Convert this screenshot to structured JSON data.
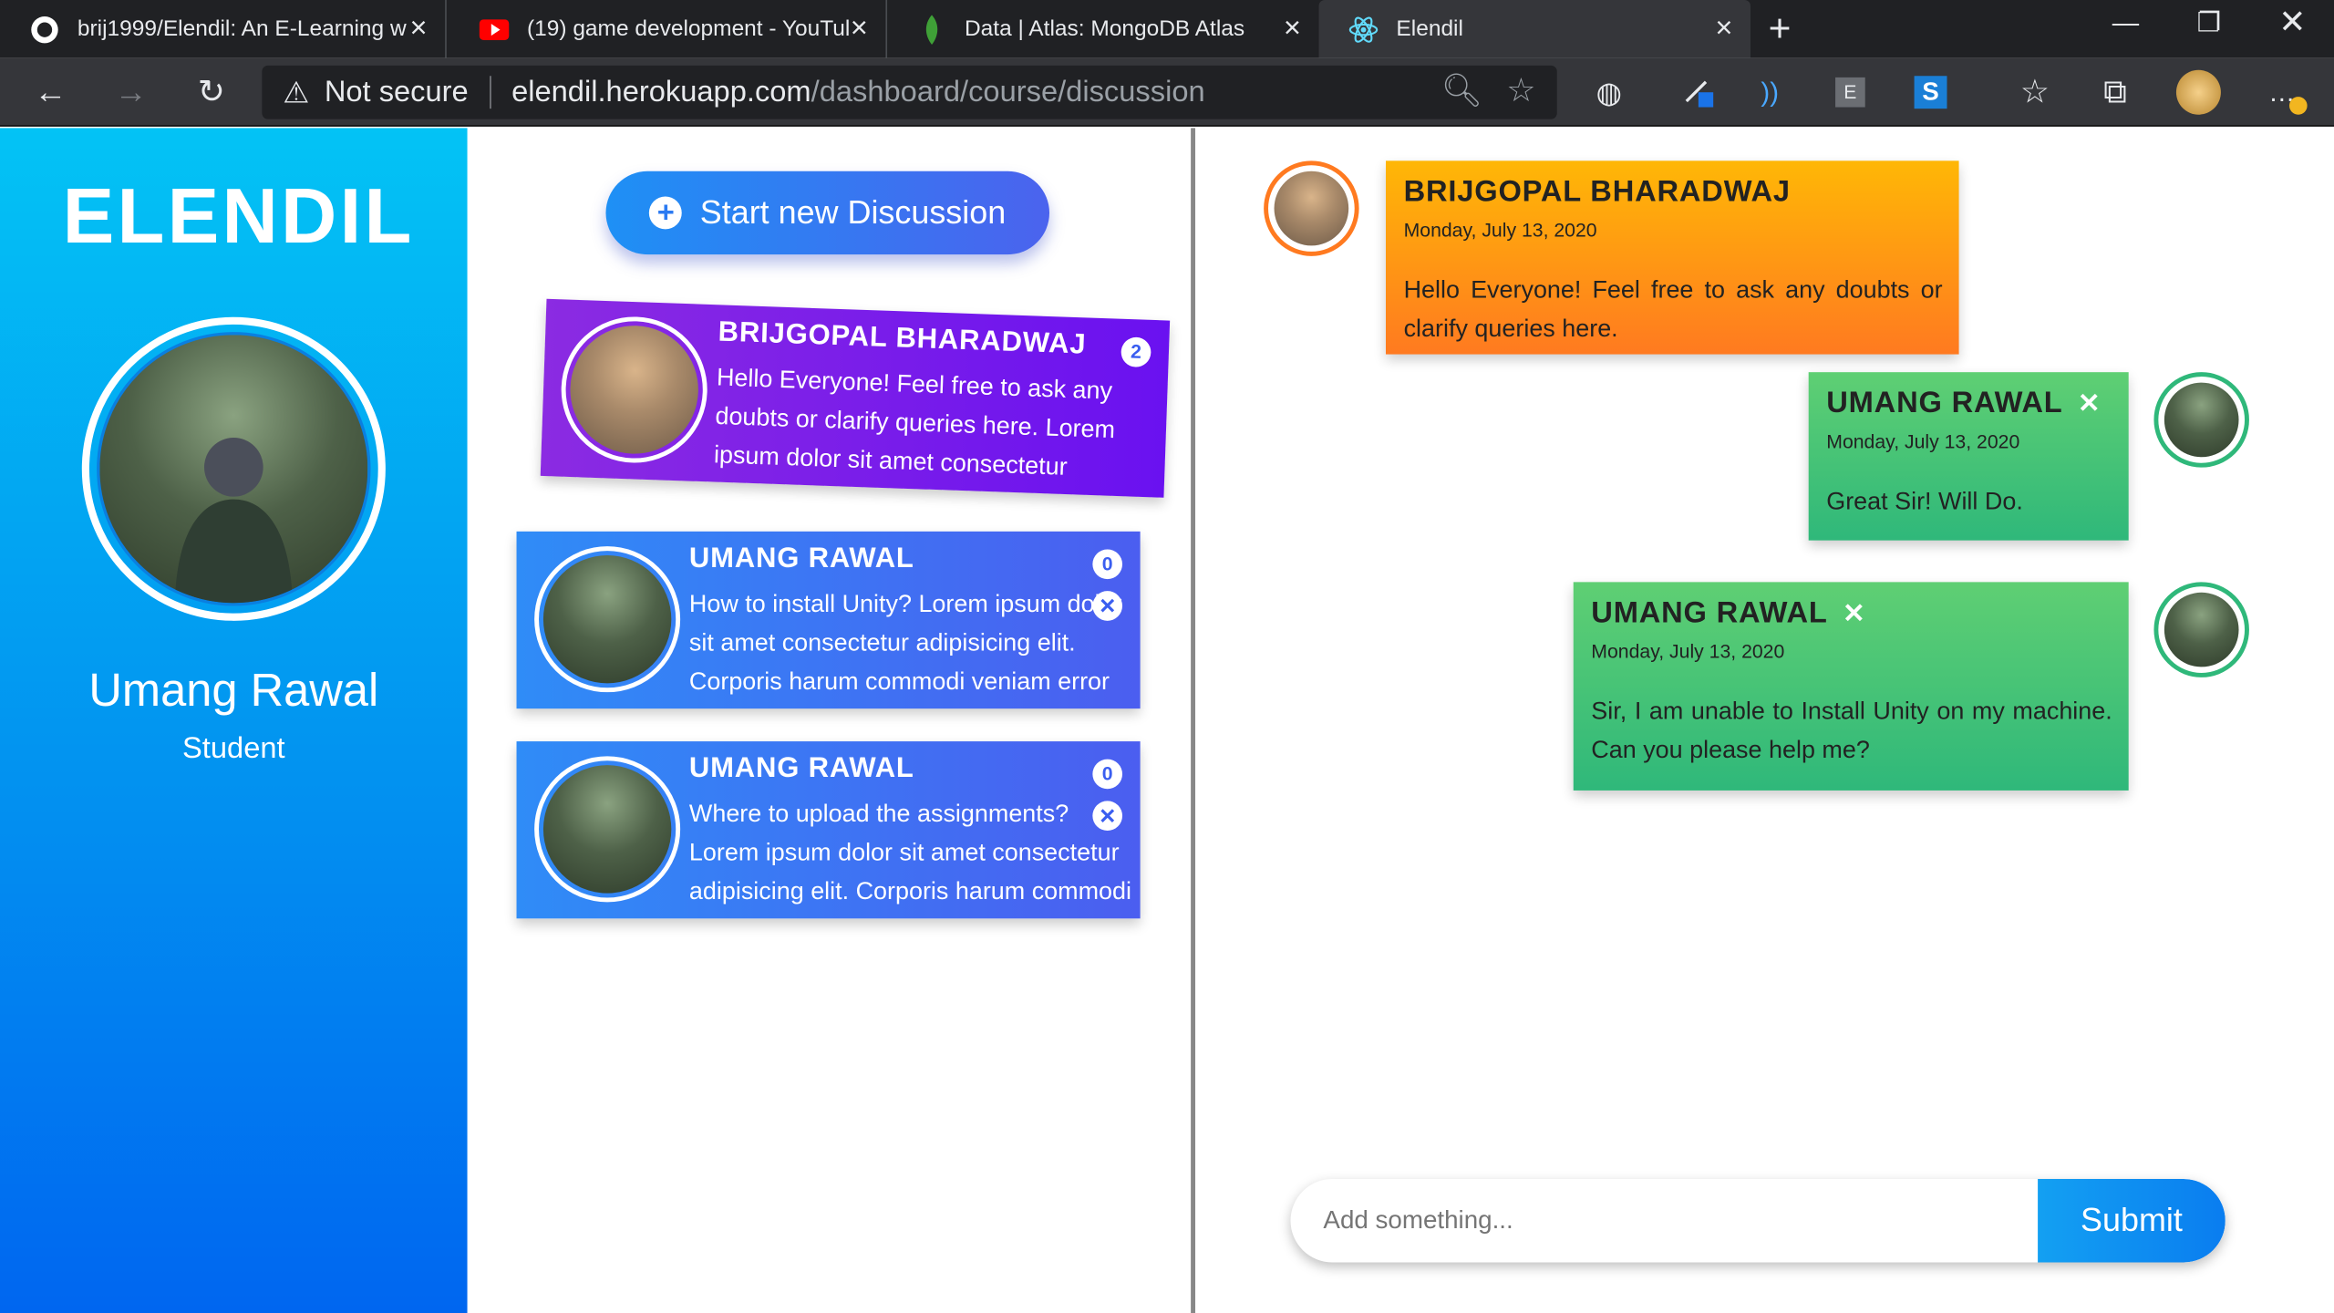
{
  "browser": {
    "tabs": [
      {
        "title": "brij1999/Elendil: An E-Learning w",
        "icon": "github-icon"
      },
      {
        "title": "(19) game development - YouTul",
        "icon": "youtube-icon"
      },
      {
        "title": "Data | Atlas: MongoDB Atlas",
        "icon": "mongodb-leaf-icon"
      },
      {
        "title": "Elendil",
        "icon": "react-icon"
      }
    ],
    "security_label": "Not secure",
    "url_host": "elendil.herokuapp.com",
    "url_path": "/dashboard/course/discussion",
    "ext_badge_e": "E",
    "ext_badge_s": "S",
    "colors": {
      "tabbar": "#202124",
      "toolbar": "#35363a"
    }
  },
  "sidebar": {
    "brand": "ELENDIL",
    "user_name": "Umang Rawal",
    "user_role": "Student",
    "colors": {
      "top": "#03c3f5",
      "bottom": "#0066f0"
    }
  },
  "discussions": {
    "new_button_label": "Start new Discussion",
    "items": [
      {
        "author": "BRIJGOPAL BHARADWAJ",
        "text": "Hello Everyone! Feel free to ask any doubts or clarify queries here. Lorem ipsum dolor sit amet consectetur",
        "count": "2"
      },
      {
        "author": "UMANG RAWAL",
        "text": "How to install Unity? Lorem ipsum dolor sit amet consectetur adipisicing elit. Corporis harum commodi veniam error",
        "count": "0"
      },
      {
        "author": "UMANG RAWAL",
        "text": "Where to upload the assignments? Lorem ipsum dolor sit amet consectetur adipisicing elit. Corporis harum commodi",
        "count": "0"
      }
    ]
  },
  "chat": {
    "messages": [
      {
        "author": "BRIJGOPAL BHARADWAJ",
        "date": "Monday, July 13, 2020",
        "text": "Hello Everyone! Feel free to ask any doubts or clarify queries here."
      },
      {
        "author": "UMANG RAWAL",
        "date": "Monday, July 13, 2020",
        "text": "Great Sir! Will Do."
      },
      {
        "author": "UMANG RAWAL",
        "date": "Monday, July 13, 2020",
        "text": "Sir, I am unable to Install Unity on my machine. Can you please help me?"
      }
    ],
    "input_placeholder": "Add something...",
    "submit_label": "Submit"
  }
}
